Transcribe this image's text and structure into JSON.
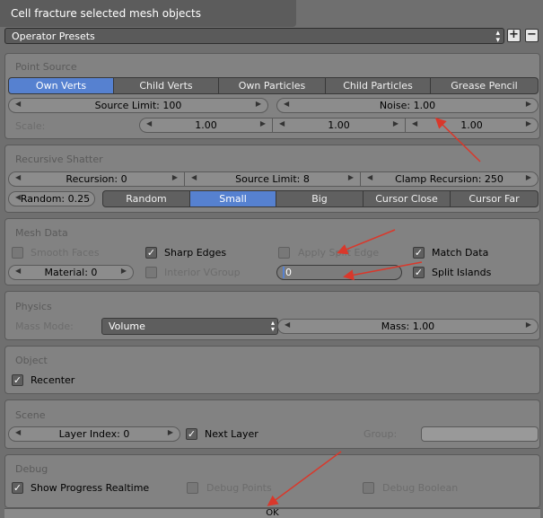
{
  "window": {
    "title": "Cell fracture selected mesh objects"
  },
  "presets": {
    "label": "Operator Presets",
    "add_icon": "plus-icon",
    "remove_icon": "minus-icon"
  },
  "point_source": {
    "title": "Point Source",
    "options": [
      "Own Verts",
      "Child Verts",
      "Own Particles",
      "Child Particles",
      "Grease Pencil"
    ],
    "active": "Own Verts",
    "source_limit": "Source Limit: 100",
    "noise": "Noise: 1.00",
    "scale_label": "Scale:",
    "scale": [
      "1.00",
      "1.00",
      "1.00"
    ]
  },
  "recursive": {
    "title": "Recursive Shatter",
    "recursion": "Recursion: 0",
    "source_limit": "Source Limit: 8",
    "clamp": "Clamp Recursion: 250",
    "random": "Random: 0.25",
    "options": [
      "Random",
      "Small",
      "Big",
      "Cursor Close",
      "Cursor Far"
    ],
    "active": "Small"
  },
  "mesh_data": {
    "title": "Mesh Data",
    "smooth_faces": "Smooth Faces",
    "sharp_edges": "Sharp Edges",
    "apply_split_edge": "Apply Split Edge",
    "match_data": "Match Data",
    "material": "Material: 0",
    "interior_vgroup": "Interior VGroup",
    "split_value": "0",
    "split_islands": "Split Islands"
  },
  "physics": {
    "title": "Physics",
    "mass_mode_label": "Mass Mode:",
    "mass_mode": "Volume",
    "mass": "Mass: 1.00"
  },
  "object": {
    "title": "Object",
    "recenter": "Recenter"
  },
  "scene": {
    "title": "Scene",
    "layer_index": "Layer Index: 0",
    "next_layer": "Next Layer",
    "group_label": "Group:",
    "group_value": ""
  },
  "debug": {
    "title": "Debug",
    "show_progress": "Show Progress Realtime",
    "debug_points": "Debug Points",
    "debug_boolean": "Debug Boolean"
  },
  "ok": {
    "label": "OK"
  },
  "colors": {
    "active": "#5681d0",
    "arrow": "#d9382b"
  }
}
